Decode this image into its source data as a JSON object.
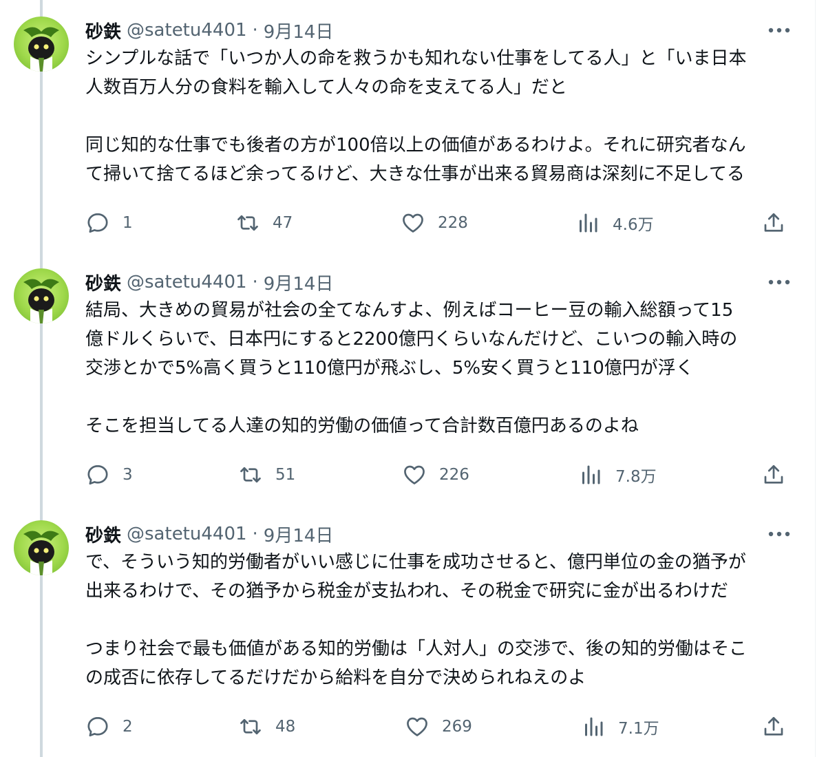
{
  "tweets": [
    {
      "name": "砂鉄",
      "handle": "@satetu4401",
      "separator": "·",
      "date": "9月14日",
      "text": "シンプルな話で「いつか人の命を救うかも知れない仕事をしてる人」と「いま日本\n人数百万人分の食料を輸入して人々の命を支えてる人」だと\n\n同じ知的な仕事でも後者の方が100倍以上の価値があるわけよ。それに研究者なん\nて掃いて捨てるほど余ってるけど、大きな仕事が出来る貿易商は深刻に不足してる",
      "replies": "1",
      "retweets": "47",
      "likes": "228",
      "views": "4.6万"
    },
    {
      "name": "砂鉄",
      "handle": "@satetu4401",
      "separator": "·",
      "date": "9月14日",
      "text": "結局、大きめの貿易が社会の全てなんすよ、例えばコーヒー豆の輸入総額って15\n億ドルくらいで、日本円にすると2200億円くらいなんだけど、こいつの輸入時の\n交渉とかで5%高く買うと110億円が飛ぶし、5%安く買うと110億円が浮く\n\nそこを担当してる人達の知的労働の価値って合計数百億円あるのよね",
      "replies": "3",
      "retweets": "51",
      "likes": "226",
      "views": "7.8万"
    },
    {
      "name": "砂鉄",
      "handle": "@satetu4401",
      "separator": "·",
      "date": "9月14日",
      "text": "で、そういう知的労働者がいい感じに仕事を成功させると、億円単位の金の猶予が\n出来るわけで、その猶予から税金が支払われ、その税金で研究に金が出るわけだ\n\nつまり社会で最も価値がある知的労働は「人対人」の交渉で、後の知的労働はそこ\nの成否に依存してるだけだから給料を自分で決められねえのよ",
      "replies": "2",
      "retweets": "48",
      "likes": "269",
      "views": "7.1万"
    }
  ],
  "icons": {
    "reply": "reply-icon",
    "retweet": "retweet-icon",
    "like": "heart-icon",
    "views": "views-icon",
    "share": "share-icon",
    "more": "more-icon"
  },
  "colors": {
    "text": "#0f1419",
    "secondary": "#536471",
    "thread_line": "#cfd9de",
    "avatar_green": "#9ed84a"
  }
}
